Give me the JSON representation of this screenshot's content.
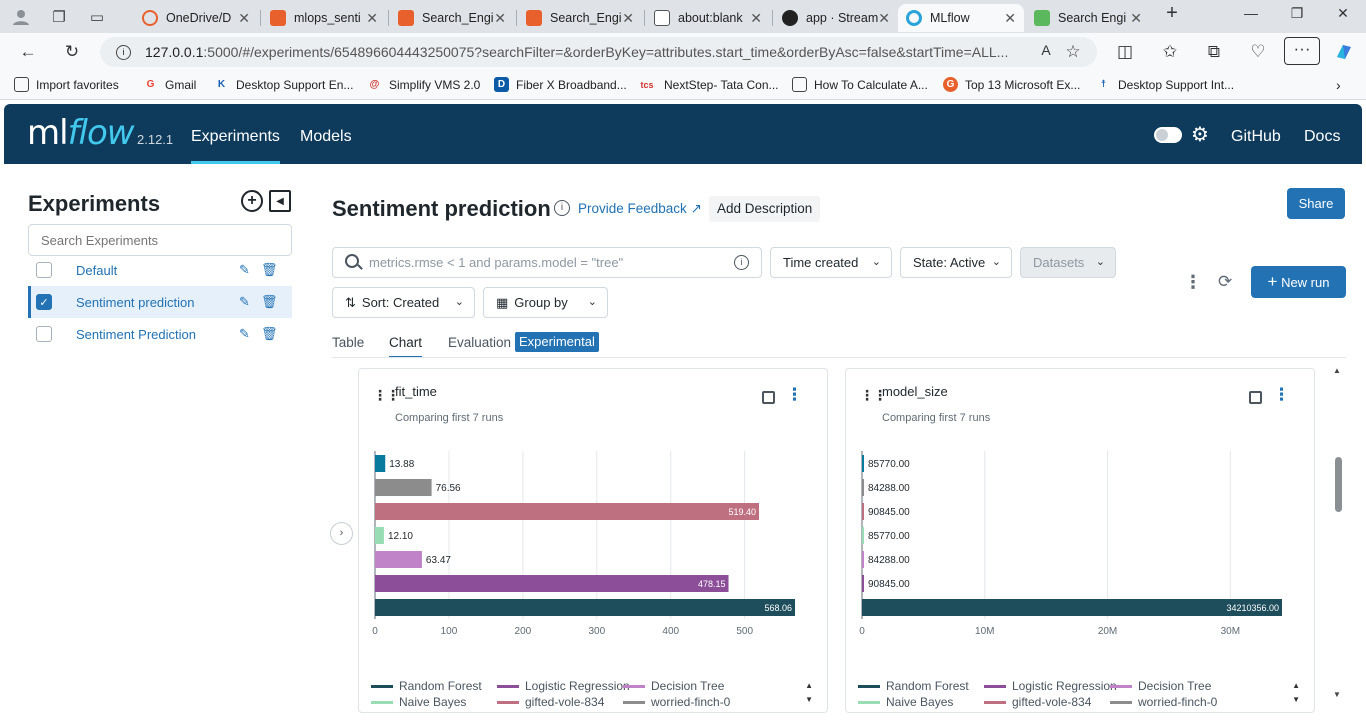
{
  "browser": {
    "tabs": [
      {
        "label": "OneDrive/D",
        "color": "#e8602c"
      },
      {
        "label": "mlops_senti",
        "color": "#e8602c"
      },
      {
        "label": "Search_Engi",
        "color": "#e8602c"
      },
      {
        "label": "Search_Engi",
        "color": "#e8602c"
      },
      {
        "label": "about:blank",
        "color": "#888888"
      },
      {
        "label": "app · Stream",
        "color": "#222222"
      },
      {
        "label": "MLflow",
        "color": "#2aa3d8"
      },
      {
        "label": "Search Engi",
        "color": "#5cb85c"
      }
    ],
    "url_host": "127.0.0.1",
    "url_rest": ":5000/#/experiments/654896604443250075?searchFilter=&orderByKey=attributes.start_time&orderByAsc=false&startTime=ALL...",
    "favorites": [
      "Import favorites",
      "Gmail",
      "Desktop Support En...",
      "Simplify VMS 2.0",
      "Fiber X Broadband...",
      "NextStep- Tata Con...",
      "How To Calculate A...",
      "Top 13 Microsoft Ex...",
      "Desktop Support Int..."
    ]
  },
  "header": {
    "logo_ml": "ml",
    "logo_flow": "flow",
    "version": "2.12.1",
    "nav": [
      "Experiments",
      "Models"
    ],
    "links": [
      "GitHub",
      "Docs"
    ]
  },
  "sidebar": {
    "title": "Experiments",
    "search_placeholder": "Search Experiments",
    "experiments": [
      {
        "name": "Default",
        "checked": false
      },
      {
        "name": "Sentiment prediction",
        "checked": true
      },
      {
        "name": "Sentiment Prediction",
        "checked": false
      }
    ]
  },
  "main": {
    "title": "Sentiment prediction",
    "feedback": "Provide Feedback",
    "add_description": "Add Description",
    "share": "Share",
    "filter_placeholder": "metrics.rmse < 1 and params.model = \"tree\"",
    "time_created": "Time created",
    "state": "State: Active",
    "datasets": "Datasets",
    "sort": "Sort: Created",
    "group_by": "Group by",
    "new_run": "New run",
    "view_tabs": [
      "Table",
      "Chart",
      "Evaluation"
    ],
    "experimental": "Experimental"
  },
  "chart_data": [
    {
      "type": "bar",
      "orientation": "horizontal",
      "title": "fit_time",
      "subtitle": "Comparing first 7 runs",
      "xlim": [
        0,
        568.06
      ],
      "xticks": [
        0,
        100,
        200,
        300,
        400,
        500
      ],
      "xtick_labels": [
        "0",
        "100",
        "200",
        "300",
        "400",
        "500"
      ],
      "bars": [
        {
          "value": 13.88,
          "label": "13.88",
          "color": "#077a9d"
        },
        {
          "value": 76.56,
          "label": "76.56",
          "color": "#8c8c8c"
        },
        {
          "value": 519.4,
          "label": "519.40",
          "color": "#bf7080"
        },
        {
          "value": 12.1,
          "label": "12.10",
          "color": "#99ddb4"
        },
        {
          "value": 63.47,
          "label": "63.47",
          "color": "#c083c8"
        },
        {
          "value": 478.15,
          "label": "478.15",
          "color": "#8c4d99"
        },
        {
          "value": 568.06,
          "label": "568.06",
          "color": "#1e4d5c"
        }
      ]
    },
    {
      "type": "bar",
      "orientation": "horizontal",
      "title": "model_size",
      "subtitle": "Comparing first 7 runs",
      "xlim": [
        0,
        34210356
      ],
      "xticks": [
        0,
        10000000,
        20000000,
        30000000
      ],
      "xtick_labels": [
        "0",
        "10M",
        "20M",
        "30M"
      ],
      "bars": [
        {
          "value": 85770.0,
          "label": "85770.00",
          "color": "#077a9d"
        },
        {
          "value": 84288.0,
          "label": "84288.00",
          "color": "#8c8c8c"
        },
        {
          "value": 90845.0,
          "label": "90845.00",
          "color": "#bf7080"
        },
        {
          "value": 85770.0,
          "label": "85770.00",
          "color": "#99ddb4"
        },
        {
          "value": 84288.0,
          "label": "84288.00",
          "color": "#c083c8"
        },
        {
          "value": 90845.0,
          "label": "90845.00",
          "color": "#8c4d99"
        },
        {
          "value": 34210356.0,
          "label": "34210356.00",
          "color": "#1e4d5c"
        }
      ]
    }
  ],
  "legend": [
    {
      "name": "Random Forest",
      "color": "#1e4d5c"
    },
    {
      "name": "Logistic Regression",
      "color": "#8c4d99"
    },
    {
      "name": "Decision Tree",
      "color": "#c083c8"
    },
    {
      "name": "Naive Bayes",
      "color": "#99ddb4"
    },
    {
      "name": "gifted-vole-834",
      "color": "#bf7080"
    },
    {
      "name": "worried-finch-0",
      "color": "#8c8c8c"
    }
  ]
}
